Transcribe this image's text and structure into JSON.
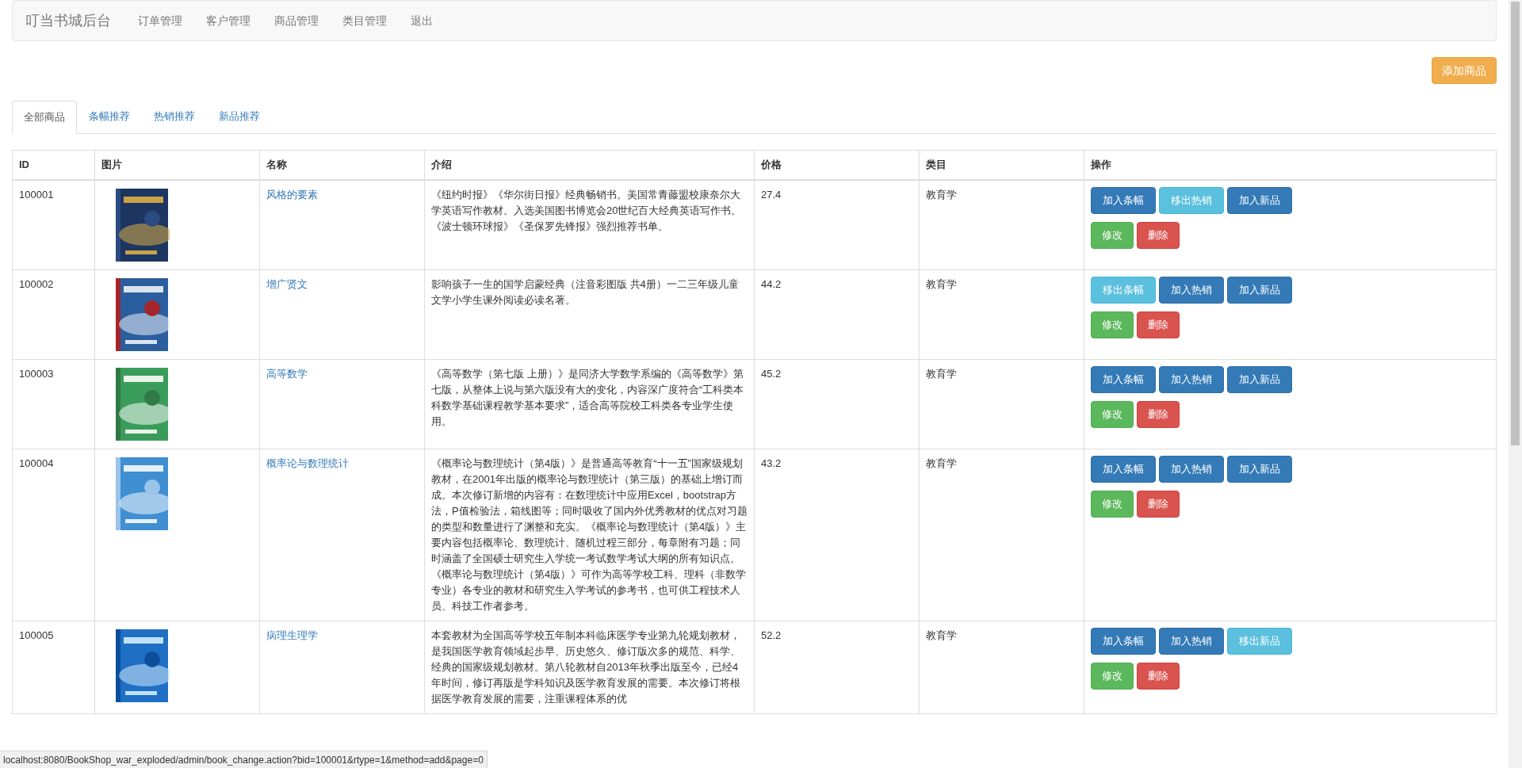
{
  "navbar": {
    "brand": "叮当书城后台",
    "items": [
      "订单管理",
      "客户管理",
      "商品管理",
      "类目管理",
      "退出"
    ]
  },
  "add_button": "添加商品",
  "tabs": [
    {
      "label": "全部商品",
      "selected": true
    },
    {
      "label": "条幅推荐",
      "selected": false
    },
    {
      "label": "热销推荐",
      "selected": false
    },
    {
      "label": "新品推荐",
      "selected": false
    }
  ],
  "table": {
    "columns": [
      "ID",
      "图片",
      "名称",
      "介绍",
      "价格",
      "类目",
      "操作"
    ],
    "rows": [
      {
        "id": "100001",
        "name": "风格的要素",
        "description": "《纽约时报》《华尔街日报》经典畅销书。美国常青藤盟校康奈尔大学英语写作教材。入选美国图书博览会20世纪百大经典英语写作书。《波士顿环球报》《圣保罗先锋报》强烈推荐书单。",
        "price": "27.4",
        "category": "教育学",
        "actions": [
          {
            "label": "加入条幅",
            "kind": "primary"
          },
          {
            "label": "移出热销",
            "kind": "info"
          },
          {
            "label": "加入新品",
            "kind": "primary"
          },
          {
            "label": "修改",
            "kind": "success"
          },
          {
            "label": "删除",
            "kind": "danger"
          }
        ]
      },
      {
        "id": "100002",
        "name": "增广贤文",
        "description": "影响孩子一生的国学启蒙经典（注音彩图版 共4册）一二三年级儿童文学小学生课外阅读必读名著。",
        "price": "44.2",
        "category": "教育学",
        "actions": [
          {
            "label": "移出条幅",
            "kind": "info"
          },
          {
            "label": "加入热销",
            "kind": "primary"
          },
          {
            "label": "加入新品",
            "kind": "primary"
          },
          {
            "label": "修改",
            "kind": "success"
          },
          {
            "label": "删除",
            "kind": "danger"
          }
        ]
      },
      {
        "id": "100003",
        "name": "高等数学",
        "description": "《高等数学（第七版 上册）》是同济大学数学系编的《高等数学》第七版，从整体上说与第六版没有大的变化，内容深广度符合“工科类本科数学基础课程教学基本要求”，适合高等院校工科类各专业学生使用。",
        "price": "45.2",
        "category": "教育学",
        "actions": [
          {
            "label": "加入条幅",
            "kind": "primary"
          },
          {
            "label": "加入热销",
            "kind": "primary"
          },
          {
            "label": "加入新品",
            "kind": "primary"
          },
          {
            "label": "修改",
            "kind": "success"
          },
          {
            "label": "删除",
            "kind": "danger"
          }
        ]
      },
      {
        "id": "100004",
        "name": "概率论与数理统计",
        "description": "《概率论与数理统计（第4版）》是普通高等教育“十一五”国家级规划教材，在2001年出版的概率论与数理统计（第三版）的基础上增订而成。本次修订新增的内容有：在数理统计中应用Excel，bootstrap方法，P值检验法，箱线图等；同时吸收了国内外优秀教材的优点对习题的类型和数量进行了渊整和充实。《概率论与数理统计（第4版）》主要内容包括概率论、数理统计、随机过程三部分，每章附有习题；同时涵盖了全国硕士研究生入学统一考试数学考试大纲的所有知识点。《概率论与数理统计（第4版）》可作为高等学校工科、理科（非数学专业）各专业的教材和研究生入学考试的参考书，也可供工程技术人员、科技工作者参考。",
        "price": "43.2",
        "category": "教育学",
        "actions": [
          {
            "label": "加入条幅",
            "kind": "primary"
          },
          {
            "label": "加入热销",
            "kind": "primary"
          },
          {
            "label": "加入新品",
            "kind": "primary"
          },
          {
            "label": "修改",
            "kind": "success"
          },
          {
            "label": "删除",
            "kind": "danger"
          }
        ]
      },
      {
        "id": "100005",
        "name": "病理生理学",
        "description": "本套教材为全国高等学校五年制本科临床医学专业第九轮规划教材，是我国医学教育领域起步早、历史悠久、修订版次多的规范、科学、经典的国家级规划教材。第八轮教材自2013年秋季出版至今，已经4年时间，修订再版是学科知识及医学教育发展的需要。本次修订将根据医学教育发展的需要，注重课程体系的优",
        "price": "52.2",
        "category": "教育学",
        "actions": [
          {
            "label": "加入条幅",
            "kind": "primary"
          },
          {
            "label": "加入热销",
            "kind": "primary"
          },
          {
            "label": "移出新品",
            "kind": "info"
          },
          {
            "label": "修改",
            "kind": "success"
          },
          {
            "label": "删除",
            "kind": "danger"
          }
        ]
      }
    ]
  },
  "status_bar": "localhost:8080/BookShop_war_exploded/admin/book_change.action?bid=100001&rtype=1&method=add&page=0"
}
